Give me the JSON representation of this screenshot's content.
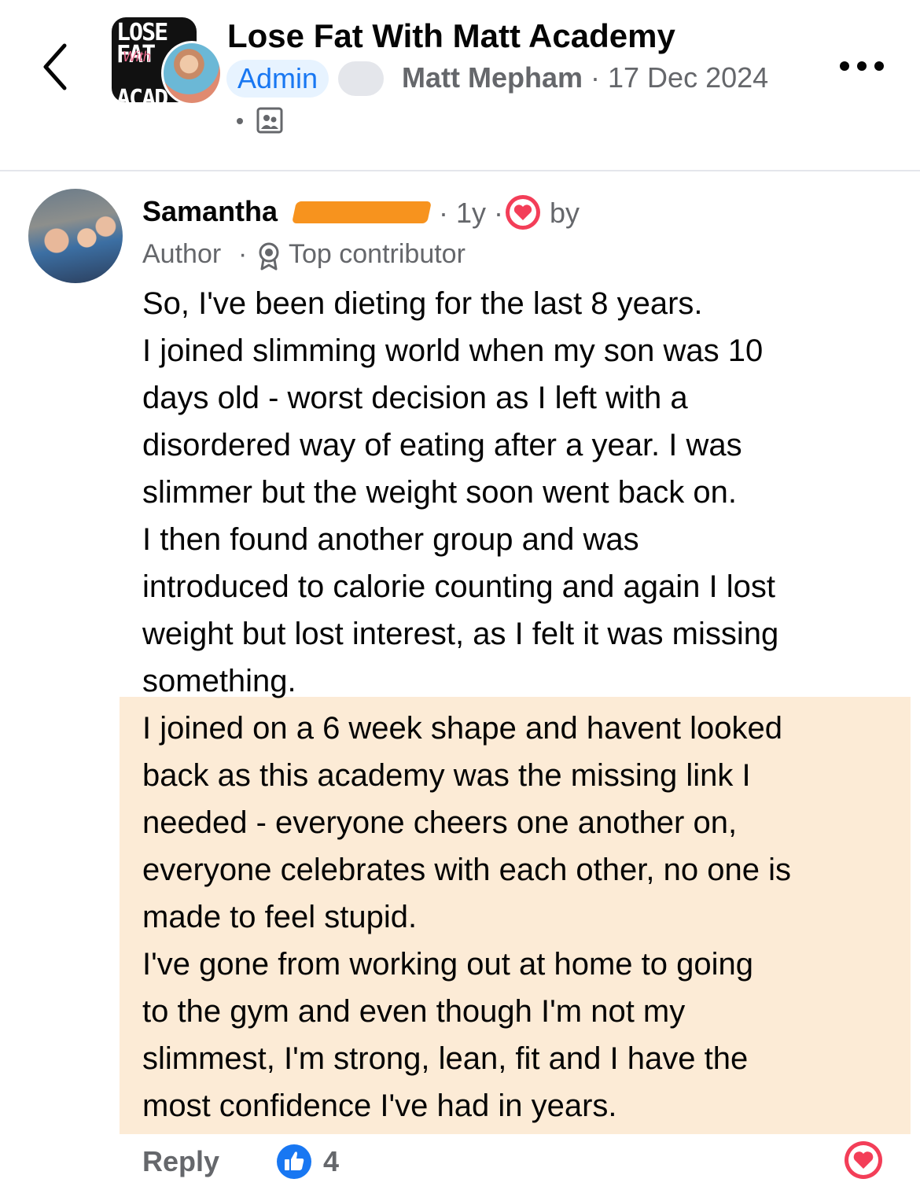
{
  "header": {
    "group_title": "Lose Fat With Matt Academy",
    "admin_badge": "Admin",
    "author_name": "Matt Mepham",
    "separator": " · ",
    "post_date": "17 Dec 2024",
    "logo_text_top": "LOSE FAT",
    "logo_text_with": "With",
    "logo_text_bottom": "ACAD"
  },
  "comment": {
    "name": "Samantha",
    "time": "· 1y ·",
    "by_label": "by",
    "author_badge": "Author",
    "badge_separator": "·",
    "contributor_badge": "Top contributor",
    "lines": [
      "So, I've been dieting for the last 8 years.",
      "I joined slimming world when my son was 10",
      "days old - worst decision as I left with a",
      "disordered way of eating after a year. I was",
      "slimmer but the weight soon went back on.",
      "I then found another group and was",
      "introduced to calorie counting and again I lost",
      "weight but lost interest, as I felt it was missing",
      "something.",
      "I joined on a 6 week shape and havent looked",
      "back as this academy was the missing link I",
      "needed - everyone cheers one another on,",
      "everyone celebrates with each other, no one is",
      "made to feel stupid.",
      "I've gone from working out at home to going",
      "to the gym and even though I'm not my",
      "slimmest, I'm strong, lean, fit and I have the",
      "most confidence I've had in years."
    ]
  },
  "footer": {
    "reply_label": "Reply",
    "like_count": "4"
  },
  "icons": {
    "back": "chevron-left-icon",
    "more": "more-horizontal-icon",
    "privacy": "members-icon",
    "heart": "heart-icon",
    "contributor": "award-ribbon-icon",
    "like": "thumbs-up-icon"
  },
  "colors": {
    "brand_blue": "#1877f2",
    "heart_red": "#f33e58",
    "highlight": "#fcebd6",
    "redaction": "#f7931e",
    "meta_gray": "#65676b"
  }
}
